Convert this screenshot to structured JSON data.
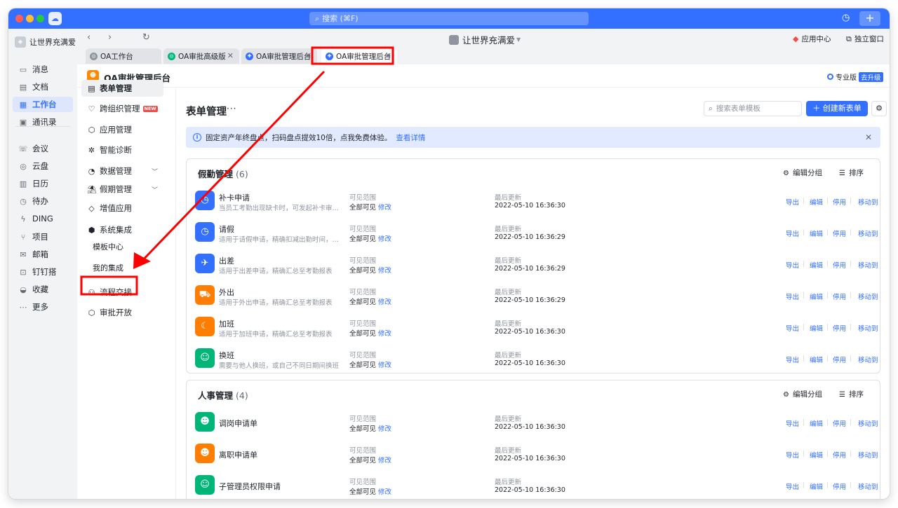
{
  "top": {
    "search_placeholder": "搜索 (⌘F)",
    "app_avatar_glyph": "☁"
  },
  "rail": {
    "org": "让世界充满爱",
    "items": [
      {
        "label": "消息",
        "icon": "message-icon",
        "glyph": "▭"
      },
      {
        "label": "文档",
        "icon": "document-icon",
        "glyph": "▤"
      },
      {
        "label": "工作台",
        "icon": "workbench-icon",
        "glyph": "▦"
      },
      {
        "label": "通讯录",
        "icon": "contacts-icon",
        "glyph": "▣"
      },
      {
        "label": "会议",
        "icon": "meeting-icon",
        "glyph": "☏"
      },
      {
        "label": "云盘",
        "icon": "cloud-drive-icon",
        "glyph": "◎"
      },
      {
        "label": "日历",
        "icon": "calendar-icon",
        "glyph": "▥"
      },
      {
        "label": "待办",
        "icon": "todo-icon",
        "glyph": "◷"
      },
      {
        "label": "DING",
        "icon": "ding-icon",
        "glyph": "ϟ"
      },
      {
        "label": "项目",
        "icon": "project-icon",
        "glyph": "⑂"
      },
      {
        "label": "邮箱",
        "icon": "mail-icon",
        "glyph": "✉"
      },
      {
        "label": "钉钉搭",
        "icon": "builder-icon",
        "glyph": "⊡"
      },
      {
        "label": "收藏",
        "icon": "favorites-icon",
        "glyph": "◒"
      },
      {
        "label": "更多",
        "icon": "more-icon",
        "glyph": "⋯"
      }
    ]
  },
  "nav": {
    "title": "让世界充满爱",
    "app_center": "应用中心",
    "detach": "独立窗口"
  },
  "tabs": [
    {
      "label": "OA工作台",
      "icon_color": "#8f959e",
      "glyph": "◎"
    },
    {
      "label": "OA审批高级版",
      "icon_color": "#00b578",
      "glyph": "◎"
    },
    {
      "label": "OA审批管理后台",
      "icon_color": "#3370ff",
      "glyph": "✚"
    },
    {
      "label": "OA审批管理后台",
      "icon_color": "#3370ff",
      "glyph": "✚"
    }
  ],
  "app": {
    "name": "OA审批管理后台",
    "edition": "专业版",
    "upgrade": "去升级"
  },
  "sidenav": {
    "items": [
      {
        "label": "表单管理",
        "glyph": "▤"
      },
      {
        "label": "跨组织管理",
        "glyph": "♡",
        "badge": "NEW"
      },
      {
        "label": "应用管理",
        "glyph": "⬡"
      },
      {
        "label": "智能诊断",
        "glyph": "✲"
      },
      {
        "label": "数据管理",
        "glyph": "◔"
      },
      {
        "label": "假期管理",
        "glyph": "⛱"
      },
      {
        "label": "增值应用",
        "glyph": "◇"
      },
      {
        "label": "系统集成",
        "glyph": "⬢"
      },
      {
        "label": "流程交接",
        "glyph": "⚇"
      },
      {
        "label": "审批开放",
        "glyph": "⬡"
      }
    ],
    "sub_items": [
      "模板中心",
      "我的集成"
    ]
  },
  "main": {
    "title": "表单管理",
    "more": "···",
    "search_placeholder": "搜索表单模板",
    "create_label": "创建新表单",
    "notice_text": "固定资产年终盘点，扫码盘点提效10倍，点我免费体验。",
    "notice_link": "查看详情",
    "edit_group": "编辑分组",
    "sort": "排序",
    "scope_label": "可见范围",
    "scope_value": "全部可见",
    "modify": "修改",
    "updated_label": "最后更新",
    "actions": [
      "导出",
      "编辑",
      "停用",
      "移动到"
    ]
  },
  "groups": [
    {
      "title": "假勤管理",
      "count": "(6)",
      "rows": [
        {
          "name": "补卡申请",
          "desc": "当员工考勤出现缺卡时，可发起补卡审批，…",
          "updated": "2022-05-10 16:36:30",
          "color": "#3370ff",
          "glyph": "◷",
          "icon": "clock-icon"
        },
        {
          "name": "请假",
          "desc": "适用于请假申请，精确扣减出勤时间，并同…",
          "updated": "2022-05-10 16:36:29",
          "color": "#3370ff",
          "glyph": "◷",
          "icon": "clock-icon"
        },
        {
          "name": "出差",
          "desc": "适用于出差申请，精确汇总至考勤报表",
          "updated": "2022-05-10 16:36:29",
          "color": "#3370ff",
          "glyph": "✈",
          "icon": "plane-icon"
        },
        {
          "name": "外出",
          "desc": "适用于外出申请，精确汇总至考勤报表",
          "updated": "2022-05-10 16:36:29",
          "color": "#ff7d00",
          "glyph": "⛟",
          "icon": "car-icon"
        },
        {
          "name": "加班",
          "desc": "适用于加班申请，精确汇总至考勤报表",
          "updated": "2022-05-10 16:36:30",
          "color": "#ff7d00",
          "glyph": "☾",
          "icon": "overtime-icon"
        },
        {
          "name": "换班",
          "desc": "需要与他人换班，或自己不同日期间换班",
          "updated": "2022-05-10 16:36:30",
          "color": "#00b578",
          "glyph": "☺",
          "icon": "shift-swap-icon"
        }
      ]
    },
    {
      "title": "人事管理",
      "count": "(4)",
      "rows": [
        {
          "name": "调岗申请单",
          "desc": "",
          "updated": "2022-05-10 16:36:30",
          "color": "#00b578",
          "glyph": "☻",
          "icon": "transfer-icon"
        },
        {
          "name": "离职申请单",
          "desc": "",
          "updated": "2022-05-10 16:36:30",
          "color": "#ff7d00",
          "glyph": "☻",
          "icon": "resign-icon"
        },
        {
          "name": "子管理员权限申请",
          "desc": "",
          "updated": "2022-05-10 16:36:30",
          "color": "#00b578",
          "glyph": "☺",
          "icon": "admin-icon"
        }
      ]
    }
  ],
  "colors": {
    "brand": "#3370ff",
    "annotation": "#ff0000"
  }
}
